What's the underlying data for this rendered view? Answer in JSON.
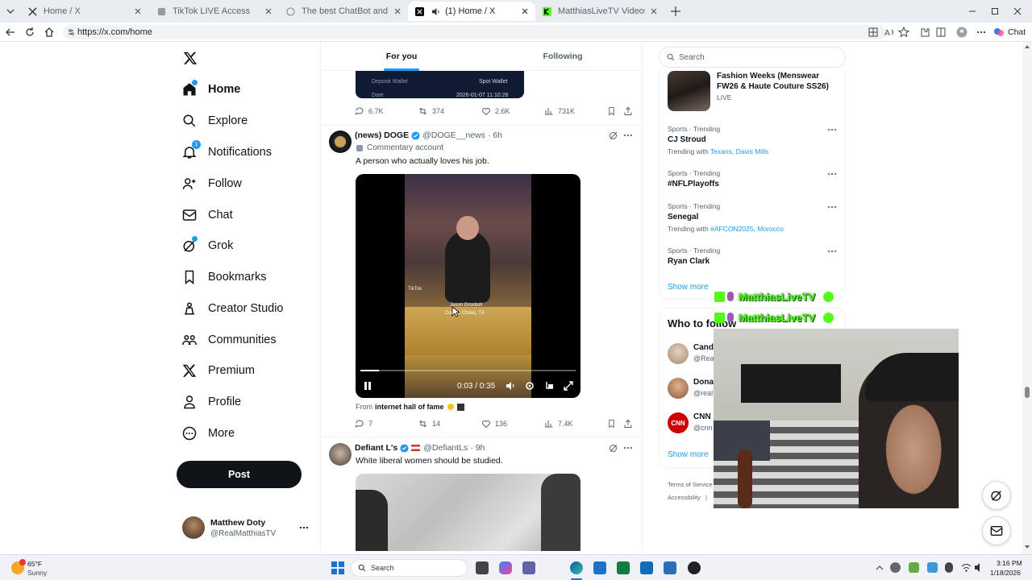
{
  "browser": {
    "tabs": [
      {
        "title": "Home / X"
      },
      {
        "title": "TikTok LIVE Access"
      },
      {
        "title": "The best ChatBot and Widgets for"
      },
      {
        "title": "(1) Home / X"
      },
      {
        "title": "MatthiasLiveTV Videos - Watch Or"
      }
    ],
    "url": "https://x.com/home",
    "chat_label": "Chat"
  },
  "nav": {
    "items": [
      {
        "label": "Home",
        "icon": "home-icon"
      },
      {
        "label": "Explore",
        "icon": "search-icon"
      },
      {
        "label": "Notifications",
        "icon": "bell-icon",
        "badge": "1"
      },
      {
        "label": "Follow",
        "icon": "person-add-icon"
      },
      {
        "label": "Chat",
        "icon": "mail-icon"
      },
      {
        "label": "Grok",
        "icon": "grok-icon"
      },
      {
        "label": "Bookmarks",
        "icon": "bookmark-icon"
      },
      {
        "label": "Creator Studio",
        "icon": "creator-studio-icon"
      },
      {
        "label": "Communities",
        "icon": "communities-icon"
      },
      {
        "label": "Premium",
        "icon": "x-logo-icon"
      },
      {
        "label": "Profile",
        "icon": "profile-icon"
      },
      {
        "label": "More",
        "icon": "more-icon"
      }
    ],
    "post_label": "Post",
    "account": {
      "name": "Matthew Doty",
      "handle": "@RealMatthiasTV"
    }
  },
  "feed": {
    "tabs": {
      "for_you": "For you",
      "following": "Following"
    },
    "prev_embed": {
      "left": "Deposit Wallet",
      "right": "Spot Wallet",
      "date_label": "Date",
      "date_value": "2026-01-07 11:10:26"
    },
    "prev_actions": {
      "replies": "6.7K",
      "reposts": "374",
      "likes": "2.6K",
      "views": "731K"
    },
    "tweet1": {
      "name": "(news) DOGE",
      "handle": "@DOGE__news",
      "time": "· 6h",
      "account_type": "Commentary account",
      "text": "A person who actually loves his job.",
      "video": {
        "overlay_name": "Jason Grosboll",
        "overlay_location": "Corpus Christi, TX",
        "watermark": "TikTok",
        "time": "0:03 / 0:35",
        "progress": 0.086
      },
      "from_prefix": "From",
      "from_source": "internet hall of fame",
      "actions": {
        "replies": "7",
        "reposts": "14",
        "likes": "136",
        "views": "7.4K"
      }
    },
    "tweet2": {
      "name": "Defiant L's",
      "handle": "@DefiantLs",
      "time": "· 9h",
      "text": "White liberal women should be studied."
    }
  },
  "right": {
    "search_placeholder": "Search",
    "live_event": {
      "title": "Fashion Weeks (Menswear FW26 & Haute Couture SS26)",
      "status": "LIVE"
    },
    "trends": [
      {
        "category": "Sports · Trending",
        "title": "CJ Stroud",
        "with_prefix": "Trending with",
        "with": [
          "Texans",
          "Davis Mills"
        ]
      },
      {
        "category": "Sports · Trending",
        "title": "#NFLPlayoffs"
      },
      {
        "category": "Sports · Trending",
        "title": "Senegal",
        "with_prefix": "Trending with",
        "with": [
          "#AFCON2025",
          "Morocco"
        ]
      },
      {
        "category": "Sports · Trending",
        "title": "Ryan Clark"
      }
    ],
    "show_more": "Show more",
    "who_to_follow": "Who to follow",
    "follow": [
      {
        "name": "Cand",
        "handle": "@Rea"
      },
      {
        "name": "Dona",
        "handle": "@real"
      },
      {
        "name": "CNN",
        "handle": "@cnn"
      }
    ],
    "show_more_2": "Show more",
    "footer": {
      "terms": "Terms of Service",
      "accessibility": "Accessibility",
      "sep": "|"
    }
  },
  "overlay": {
    "streamer": "MatthiasLiveTV"
  },
  "taskbar": {
    "weather_temp": "65°F",
    "weather_desc": "Sunny",
    "search_label": "Search",
    "time": "3:16 PM",
    "date": "1/18/2026"
  },
  "colors": {
    "accent": "#1d9bf0",
    "text": "#0f1419",
    "muted": "#536471",
    "streamer_green": "#53fc18"
  }
}
